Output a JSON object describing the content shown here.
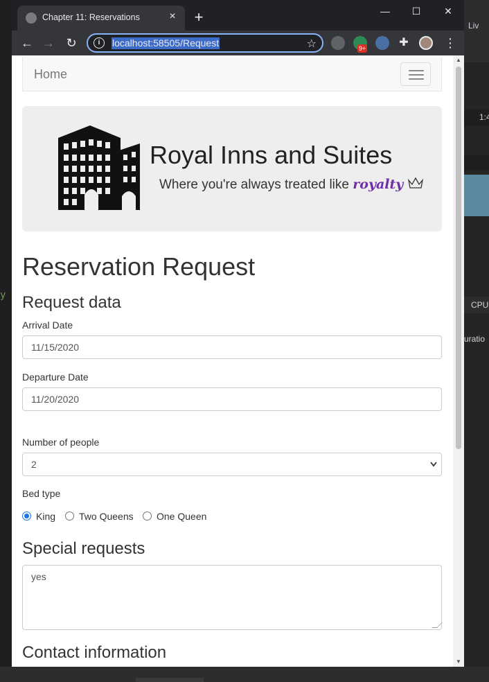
{
  "background_ide": {
    "left_text": "y",
    "right_labels": {
      "live": "Liv",
      "cpu": "CPU",
      "duration": "uratio",
      "timer": "1:4"
    }
  },
  "browser": {
    "tab_title": "Chapter 11: Reservations",
    "tab_close_icon": "×",
    "new_tab_icon": "+",
    "url": "localhost:58505/Request",
    "extension_badge": "9+",
    "window_controls": {
      "minimize": "—",
      "maximize": "☐",
      "close": "✕"
    }
  },
  "navbar": {
    "brand": "Home"
  },
  "jumbotron": {
    "logo_title": "Royal Inns and Suites",
    "logo_tagline": "Where you're always treated like",
    "logo_tagline_accent": "royalty"
  },
  "form": {
    "title": "Reservation Request",
    "request_data_heading": "Request data",
    "arrival_label": "Arrival Date",
    "arrival_value": "11/15/2020",
    "departure_label": "Departure Date",
    "departure_value": "11/20/2020",
    "people_label": "Number of people",
    "people_value": "2",
    "bed_type_label": "Bed type",
    "bed_options": [
      {
        "label": "King",
        "selected": true
      },
      {
        "label": "Two Queens",
        "selected": false
      },
      {
        "label": "One Queen",
        "selected": false
      }
    ],
    "special_requests_heading": "Special requests",
    "special_requests_value": "yes",
    "contact_heading": "Contact information"
  },
  "colors": {
    "accent": "#1a73e8",
    "royalty": "#6f2da8",
    "chrome_dark": "#202124",
    "chrome_toolbar": "#35363a",
    "url_highlight": "#3d6bc8"
  }
}
